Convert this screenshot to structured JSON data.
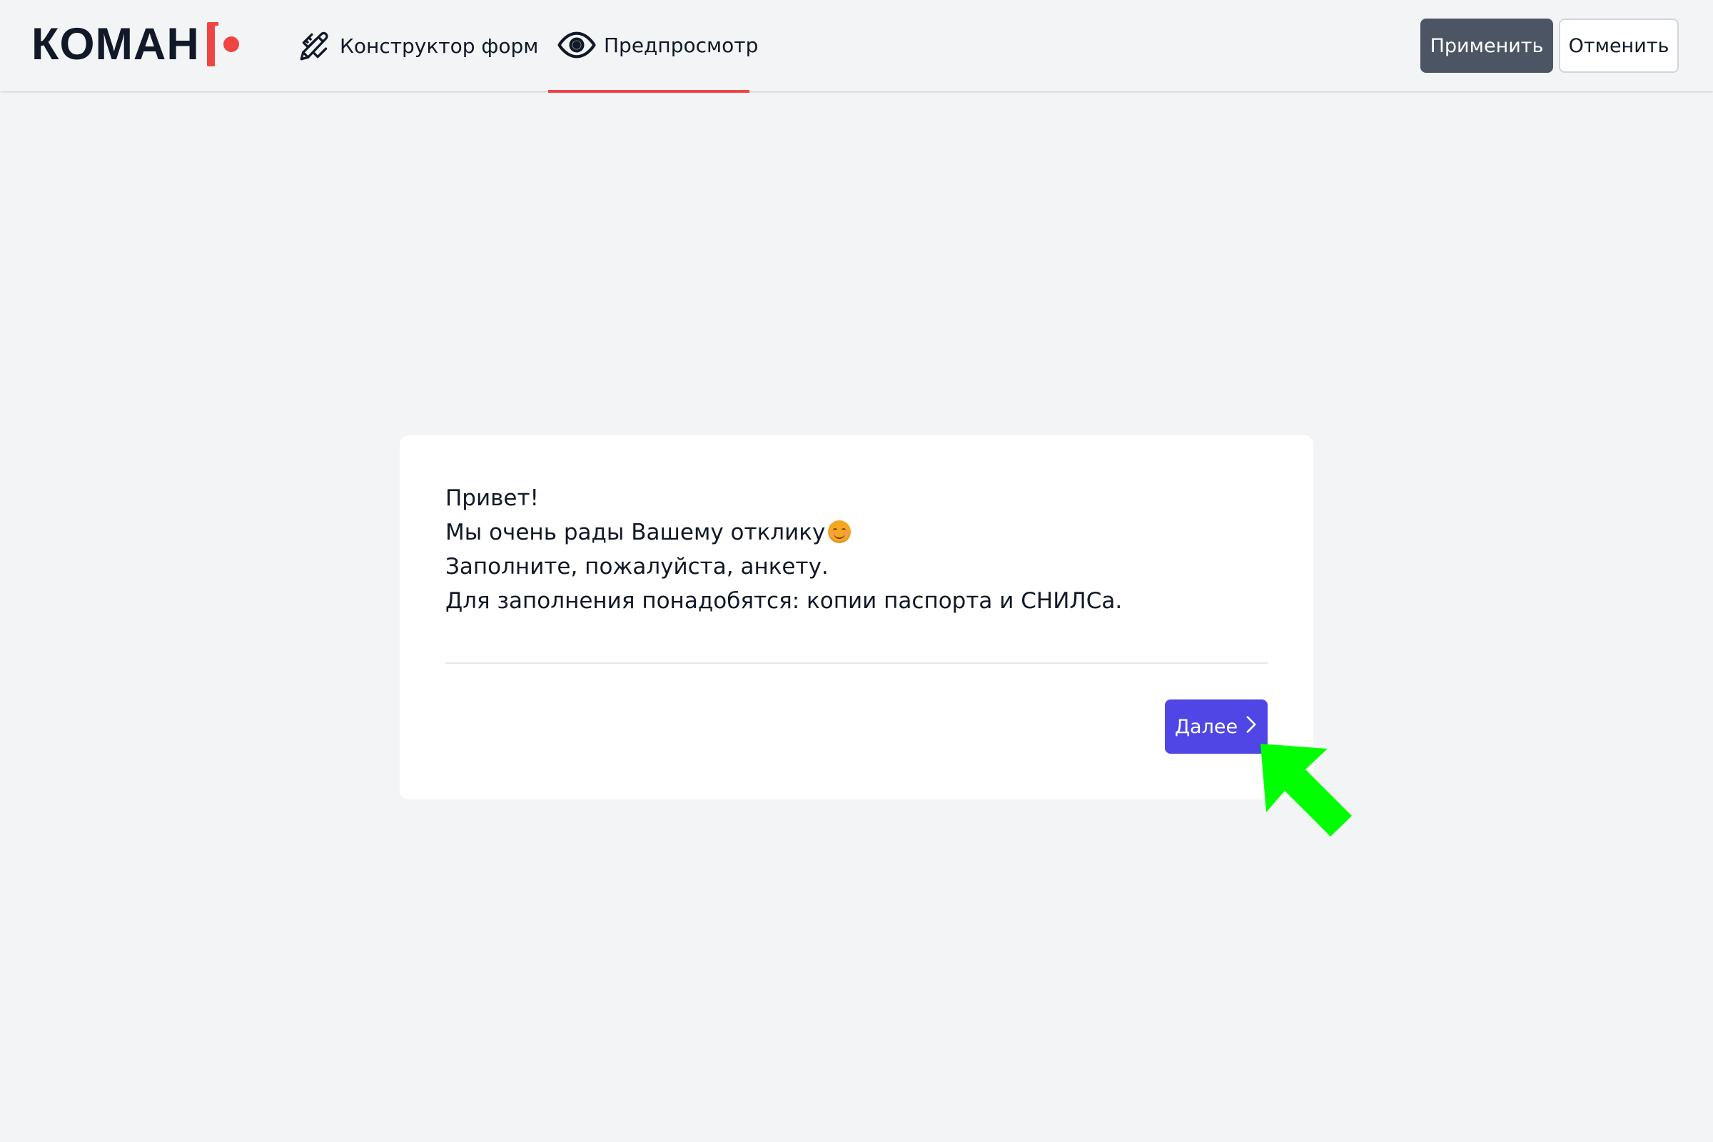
{
  "header": {
    "logo_text": "КОМАН",
    "tabs": [
      {
        "label": "Конструктор форм",
        "icon": "pencil-ruler-icon",
        "active": false
      },
      {
        "label": "Предпросмотр",
        "icon": "eye-icon",
        "active": true
      }
    ],
    "apply_label": "Применить",
    "cancel_label": "Отменить"
  },
  "form": {
    "lines": [
      "Привет!",
      "Мы очень рады Вашему отклику",
      "Заполните, пожалуйста, анкету.",
      "Для заполнения понадобятся: копии паспорта и СНИЛСа."
    ],
    "emoji": "smiling-face-icon",
    "next_label": "Далее",
    "next_icon": "chevron-right-icon"
  },
  "colors": {
    "accent_red": "#ef4444",
    "primary_button": "#4f46e5",
    "apply_button": "#4b5563",
    "pointer": "#00ff00"
  }
}
